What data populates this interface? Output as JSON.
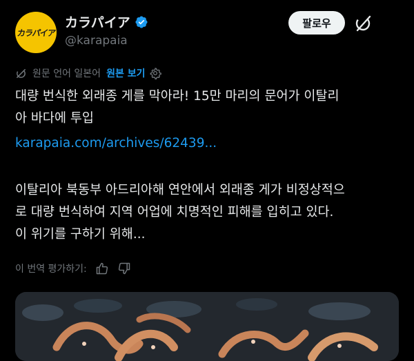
{
  "header": {
    "avatar_text": "カラパイア",
    "display_name": "カラパイア",
    "handle": "@karapaia",
    "follow_label": "팔로우"
  },
  "translation": {
    "label": "원문 언어 일본어",
    "view_original": "원본 보기"
  },
  "post": {
    "line1": "대량 번식한 외래종 게를 막아라! 15만 마리의 문어가 이탈리",
    "line2": "아 바다에 투입",
    "link": "karapaia.com/archives/62439...",
    "para_line1": "이탈리아 북동부 아드리아해 연안에서 외래종 게가 비정상적으",
    "para_line2": "로 대량 번식하여 지역 어업에 치명적인 피해를 입히고 있다.",
    "para_line3": "이 위기를 구하기 위해..."
  },
  "rating": {
    "label": "이 번역 평가하기:"
  },
  "colors": {
    "background": "#000000",
    "accent": "#1d9bf0",
    "avatar_bg": "#f5c400",
    "muted": "#71767b"
  },
  "icons": [
    "verified-badge-icon",
    "grok-icon",
    "translate-icon",
    "gear-icon",
    "thumbs-up-icon",
    "thumbs-down-icon"
  ]
}
